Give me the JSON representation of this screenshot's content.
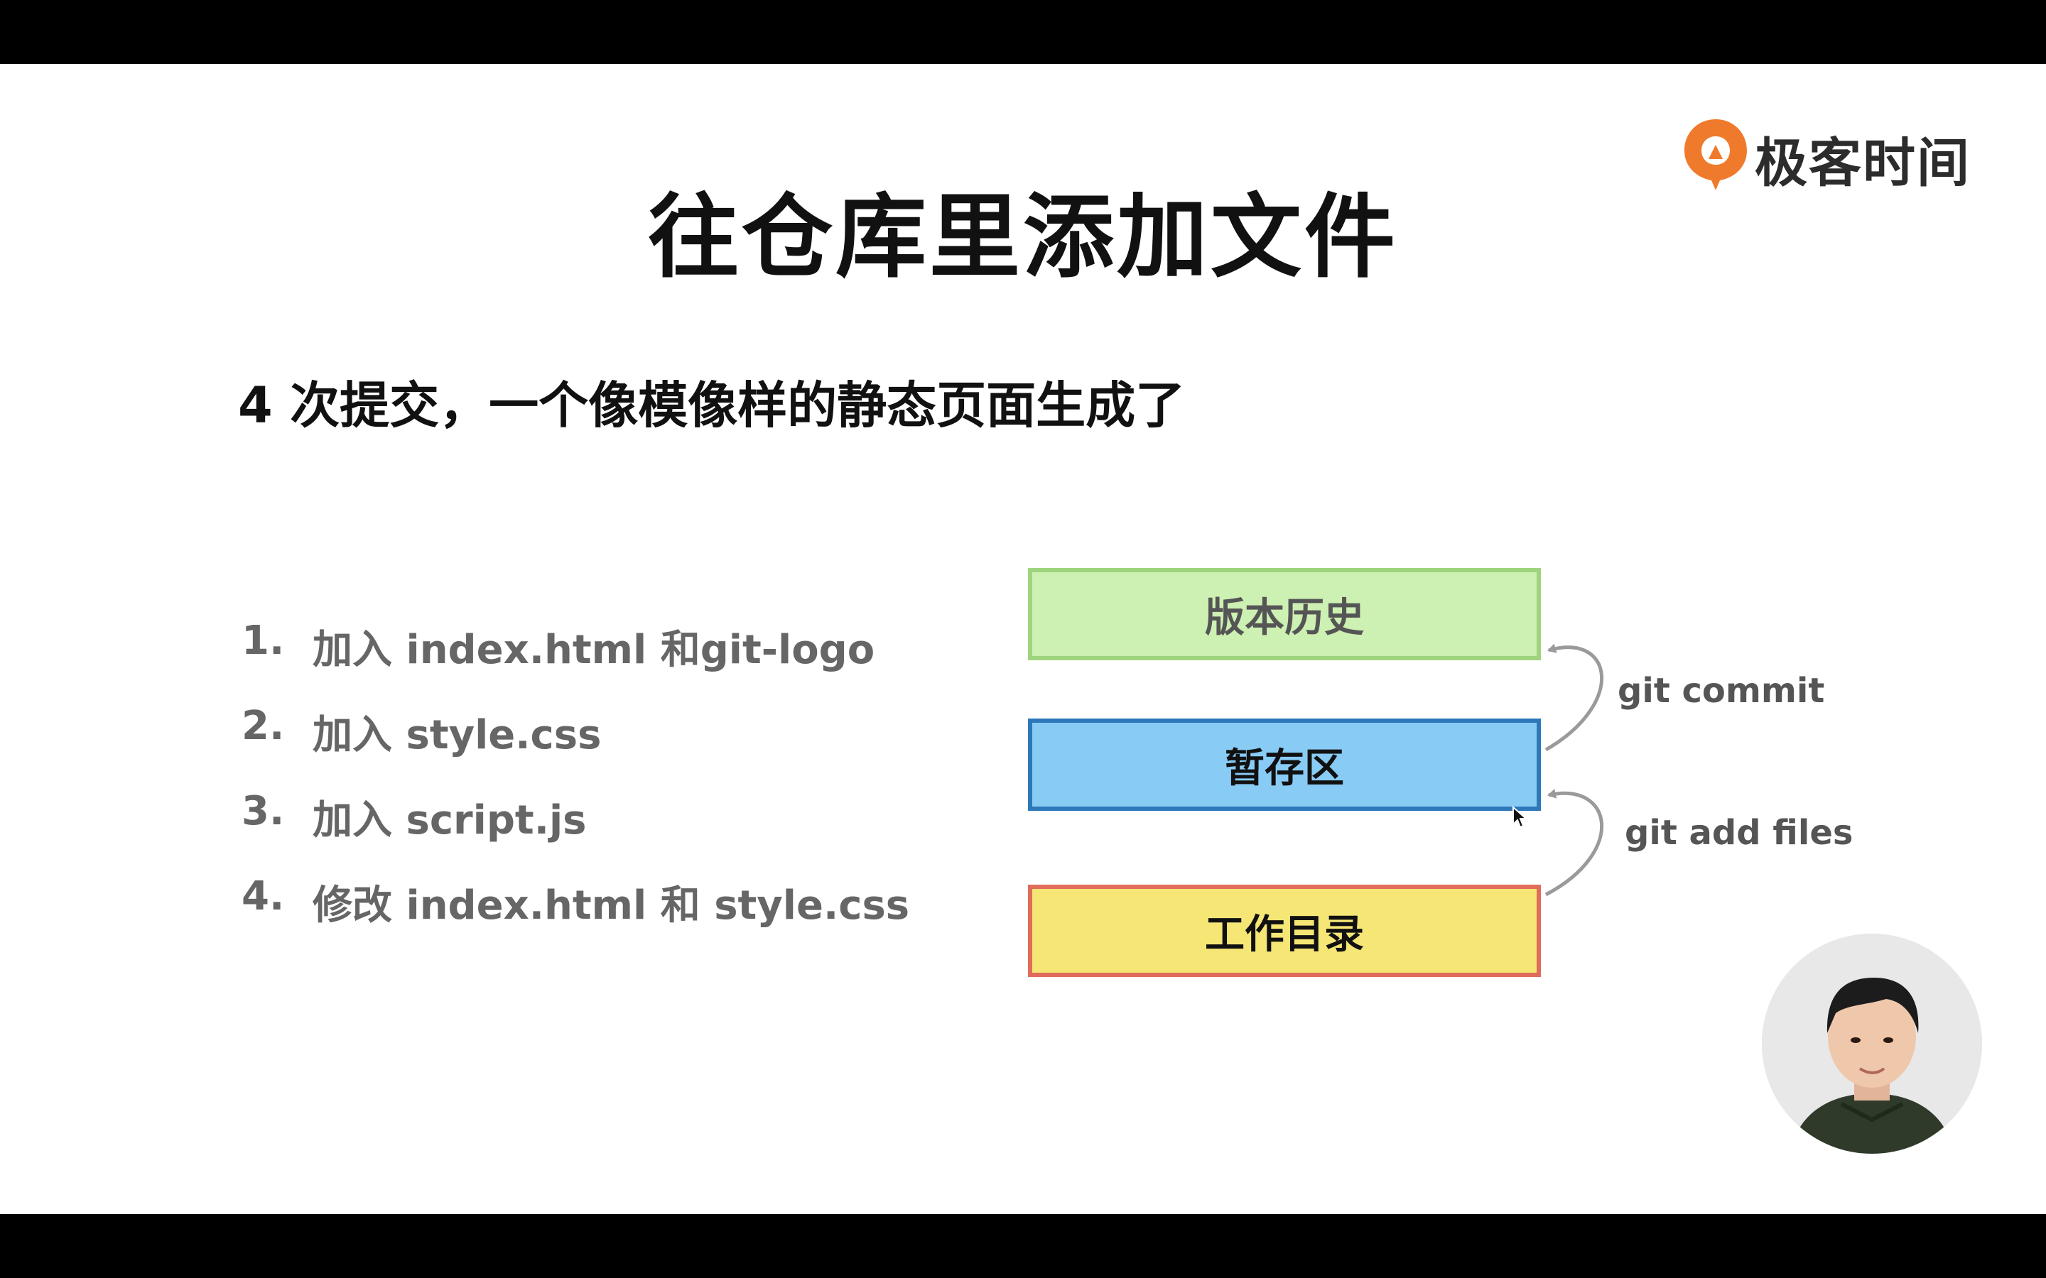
{
  "brand": {
    "name": "极客时间",
    "logo_color": "#f07a2b"
  },
  "slide": {
    "title": "往仓库里添加文件",
    "subtitle": "4 次提交，一个像模像样的静态页面生成了",
    "steps": [
      {
        "num": "1.",
        "text": "加入 index.html 和git-logo"
      },
      {
        "num": "2.",
        "text": "加入 style.css"
      },
      {
        "num": "3.",
        "text": "加入 script.js"
      },
      {
        "num": "4.",
        "text": "修改 index.html 和 style.css"
      }
    ]
  },
  "diagram": {
    "boxes": {
      "history": {
        "label": "版本历史",
        "fill": "#cdf0b3",
        "border": "#9fd47f"
      },
      "stage": {
        "label": "暂存区",
        "fill": "#88cbf5",
        "border": "#2d78b9"
      },
      "work": {
        "label": "工作目录",
        "fill": "#f5e676",
        "border": "#e06c5a"
      }
    },
    "commands": {
      "commit": "git commit",
      "add": "git add files"
    }
  }
}
